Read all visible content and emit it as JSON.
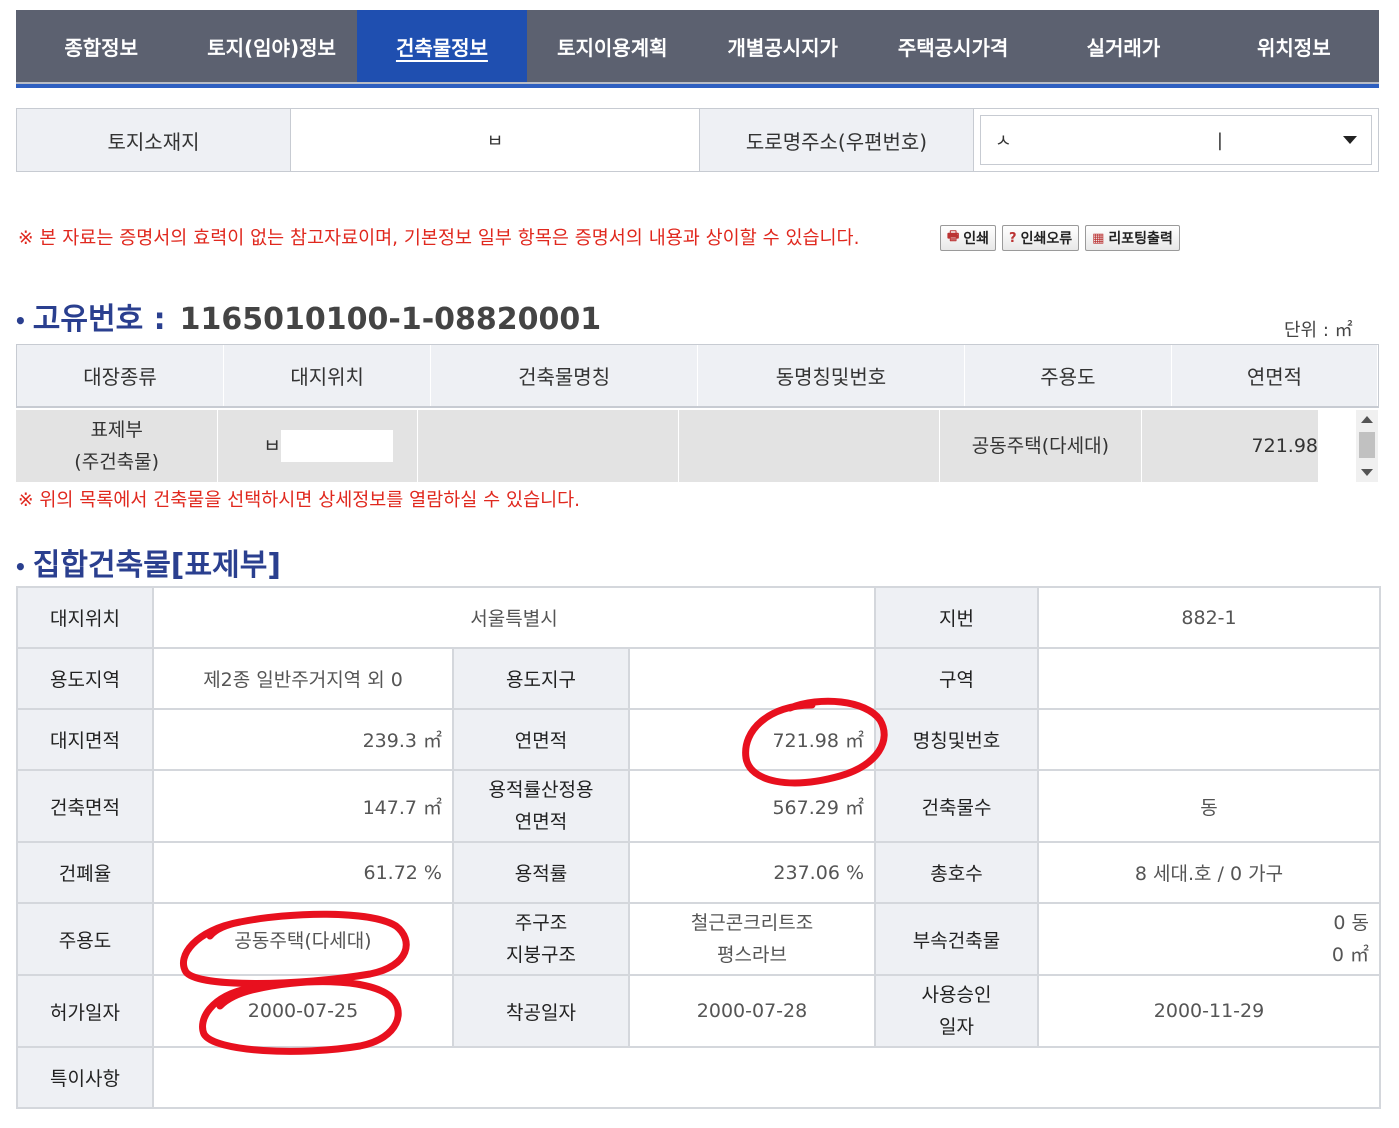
{
  "tabs": [
    "종합정보",
    "토지(임야)정보",
    "건축물정보",
    "토지이용계획",
    "개별공시지가",
    "주택공시가격",
    "실거래가",
    "위치정보"
  ],
  "address": {
    "land_label": "토지소재지",
    "land_value": "ㅂ",
    "road_label": "도로명주소(우편번호)",
    "road_value": "ㅅ",
    "road_value_end": "|"
  },
  "notice": "※ 본 자료는 증명서의 효력이 없는 참고자료이며, 기본정보 일부 항목은 증명서의 내용과 상이할 수 있습니다.",
  "buttons": {
    "print": "인쇄",
    "print_error": "인쇄오류",
    "report": "리포팅출력"
  },
  "unique": {
    "label": "고유번호 :",
    "number": "1165010100-1-08820001"
  },
  "unit": "단위 : ㎡",
  "list": {
    "headers": [
      "대장종류",
      "대지위치",
      "건축물명칭",
      "동명칭및번호",
      "주용도",
      "연면적"
    ],
    "row": {
      "type_line1": "표제부",
      "type_line2": "(주건축물)",
      "location": "ㅂ",
      "name": "",
      "dong": "",
      "use": "공동주택(다세대)",
      "area": "721.98"
    }
  },
  "notice2": "※ 위의 목록에서 건축물을 선택하시면 상세정보를 열람하실 수 있습니다.",
  "section_title": "집합건축물[표제부]",
  "detail": {
    "site_label": "대지위치",
    "site_value": "서울특별시",
    "lot_label": "지번",
    "lot_value": "882-1",
    "zone_label": "용도지역",
    "zone_value": "제2종 일반주거지역 외 0",
    "district_label": "용도지구",
    "district_value": "",
    "area_label": "구역",
    "area_value": "",
    "land_area_label": "대지면적",
    "land_area_value": "239.3 ㎡",
    "floor_area_label": "연면적",
    "floor_area_value": "721.98 ㎡",
    "name_label": "명칭및번호",
    "name_value": "",
    "building_area_label": "건축면적",
    "building_area_value": "147.7 ㎡",
    "far_area_label1": "용적률산정용",
    "far_area_label2": "연면적",
    "far_area_value": "567.29 ㎡",
    "count_label": "건축물수",
    "count_value": "동",
    "bcr_label": "건폐율",
    "bcr_value": "61.72 %",
    "far_label": "용적률",
    "far_value": "237.06 %",
    "units_label": "총호수",
    "units_value": "8 세대.호 / 0 가구",
    "use_label": "주용도",
    "use_value": "공동주택(다세대)",
    "structure_label1": "주구조",
    "structure_label2": "지붕구조",
    "structure_value1": "철근콘크리트조",
    "structure_value2": "평스라브",
    "annex_label": "부속건축물",
    "annex_value1": "0 동",
    "annex_value2": "0 ㎡",
    "permit_label": "허가일자",
    "permit_value": "2000-07-25",
    "start_label": "착공일자",
    "start_value": "2000-07-28",
    "approval_label1": "사용승인",
    "approval_label2": "일자",
    "approval_value": "2000-11-29",
    "remarks_label": "특이사항",
    "remarks_value": ""
  },
  "colors": {
    "tab_bg": "#5c6170",
    "tab_active": "#1f4fb0",
    "notice_red": "#e0281e",
    "heading_blue": "#2a3f8f",
    "marker_red": "#e8101e"
  }
}
